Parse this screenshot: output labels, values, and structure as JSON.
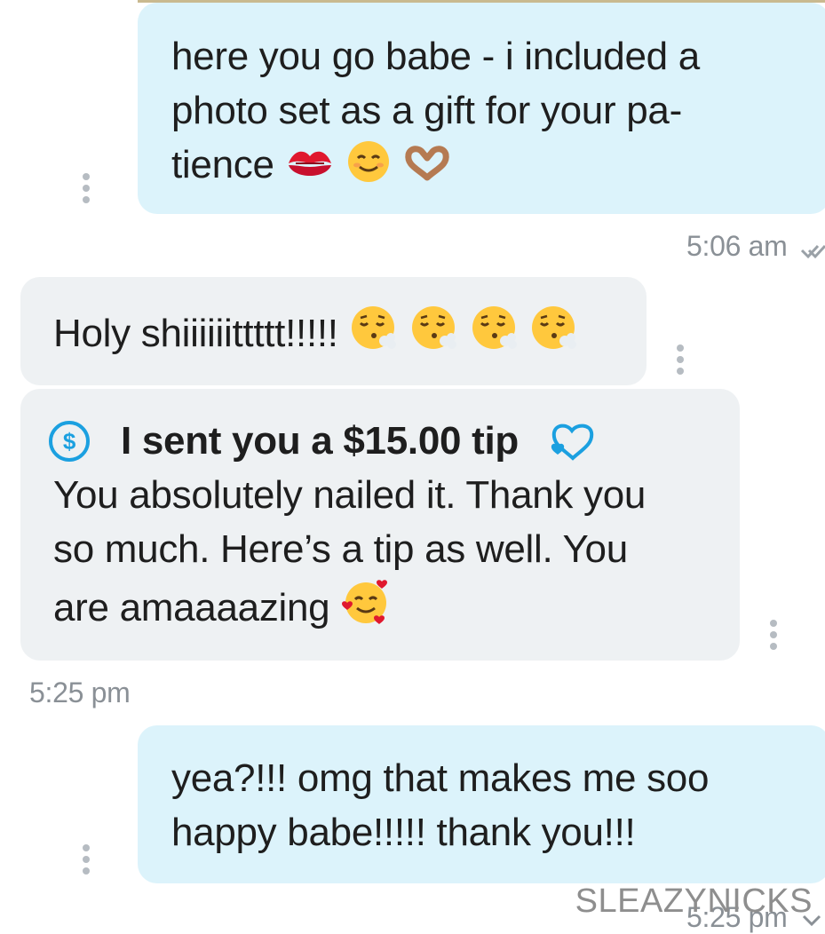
{
  "messages": [
    {
      "id": "m1",
      "side": "outgoing",
      "lines": [
        "here you go babe - i included a",
        "photo set as a gift for your pa-",
        "tience"
      ],
      "emoji": [
        "kiss-mark",
        "smiling-face",
        "heart-hands"
      ],
      "time": "5:06 am"
    },
    {
      "id": "m2",
      "side": "incoming",
      "text": "Holy shiiiiiittttt!!!!!",
      "emoji": [
        "face-exhaling",
        "face-exhaling",
        "face-exhaling",
        "face-exhaling"
      ]
    },
    {
      "id": "m3",
      "side": "incoming",
      "tip_label": "I sent you a $15.00 tip",
      "lines": [
        "You absolutely nailed it. Thank you",
        "so much. Here’s a tip as well. You",
        "are amaaaazing"
      ],
      "emoji": [
        "smiling-face-with-hearts"
      ],
      "time": "5:25 pm"
    },
    {
      "id": "m4",
      "side": "outgoing",
      "lines": [
        "yea?!!! omg that makes me soo",
        "happy babe!!!!! thank you!!!"
      ],
      "time": "5:25 pm"
    }
  ],
  "watermark": "SLEAZYNICKS",
  "colors": {
    "outgoing_bubble": "#dcf3fb",
    "incoming_bubble": "#eef1f3",
    "accent": "#1ba0e0",
    "timestamp": "#8a9096"
  }
}
